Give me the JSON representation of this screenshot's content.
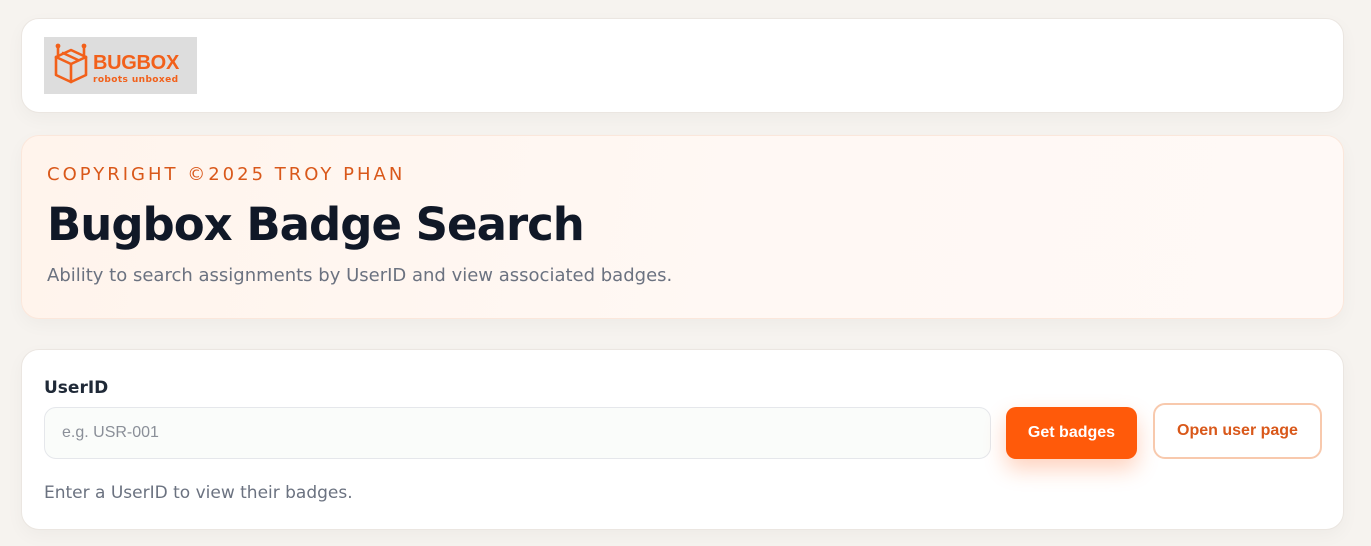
{
  "header": {
    "logo": {
      "wordmark": "BUGBOX",
      "tagline": "robots unboxed",
      "icon": "robot-box-icon",
      "color": "#f2601a"
    }
  },
  "hero": {
    "eyebrow": "COPYRIGHT ©2025 TROY PHAN",
    "title": "Bugbox Badge Search",
    "subtitle": "Ability to search assignments by UserID and view associated badges."
  },
  "search": {
    "label": "UserID",
    "placeholder": "e.g. USR-001",
    "value": "",
    "primary_button": "Get badges",
    "secondary_button": "Open user page",
    "hint": "Enter a UserID to view their badges."
  },
  "colors": {
    "accent": "#ff5a0a",
    "accent_text": "#d9581a",
    "heading": "#101827",
    "muted": "#6b7280",
    "page_background": "#f6f3ef"
  }
}
